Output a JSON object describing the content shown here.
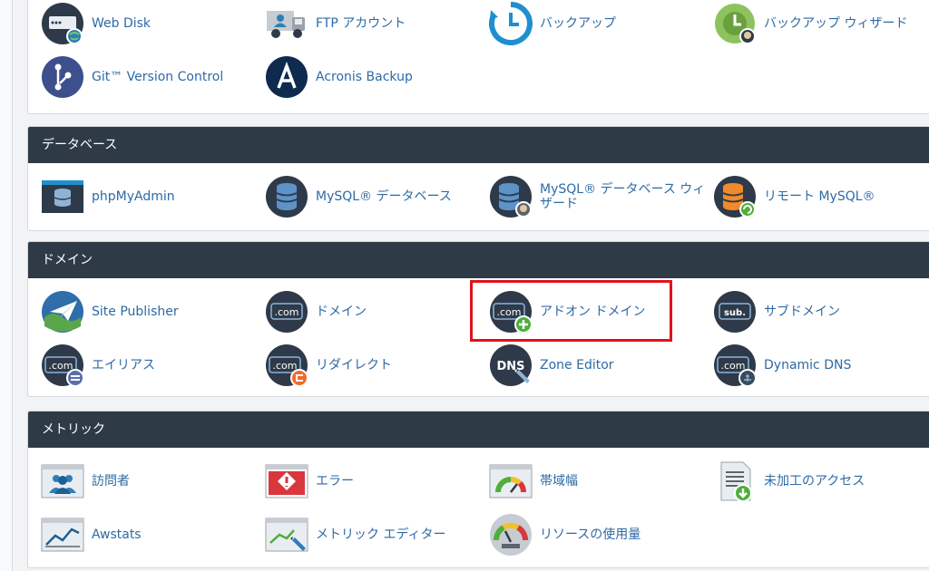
{
  "files": {
    "items": [
      {
        "label": "Web Disk",
        "icon": "web-disk-icon"
      },
      {
        "label": "FTP アカウント",
        "icon": "ftp-truck-icon"
      },
      {
        "label": "バックアップ",
        "icon": "backup-clock-icon"
      },
      {
        "label": "バックアップ ウィザード",
        "icon": "backup-wizard-icon"
      },
      {
        "label": "Git™ Version Control",
        "icon": "git-branch-icon"
      },
      {
        "label": "Acronis Backup",
        "icon": "acronis-icon"
      }
    ]
  },
  "databases": {
    "title": "データベース",
    "items": [
      {
        "label": "phpMyAdmin",
        "icon": "phpmyadmin-icon"
      },
      {
        "label": "MySQL® データベース",
        "icon": "database-icon"
      },
      {
        "label": "MySQL® データベース ウィザード",
        "icon": "database-wizard-icon"
      },
      {
        "label": "リモート MySQL®",
        "icon": "remote-database-icon"
      }
    ]
  },
  "domains": {
    "title": "ドメイン",
    "items": [
      {
        "label": "Site Publisher",
        "icon": "site-publisher-icon"
      },
      {
        "label": "ドメイン",
        "icon": "domain-com-icon",
        "badge": ".com"
      },
      {
        "label": "アドオン ドメイン",
        "icon": "addon-domain-icon",
        "badge": ".com"
      },
      {
        "label": "サブドメイン",
        "icon": "subdomain-icon",
        "badge": "sub."
      },
      {
        "label": "エイリアス",
        "icon": "alias-icon",
        "badge": ".com"
      },
      {
        "label": "リダイレクト",
        "icon": "redirect-icon",
        "badge": ".com"
      },
      {
        "label": "Zone Editor",
        "icon": "zone-editor-icon",
        "badge": "DNS"
      },
      {
        "label": "Dynamic DNS",
        "icon": "dynamic-dns-icon",
        "badge": ".com"
      }
    ]
  },
  "metrics": {
    "title": "メトリック",
    "items": [
      {
        "label": "訪問者",
        "icon": "visitors-icon"
      },
      {
        "label": "エラー",
        "icon": "errors-icon"
      },
      {
        "label": "帯域幅",
        "icon": "bandwidth-gauge-icon"
      },
      {
        "label": "未加工のアクセス",
        "icon": "raw-access-icon"
      },
      {
        "label": "Awstats",
        "icon": "awstats-chart-icon"
      },
      {
        "label": "メトリック エディター",
        "icon": "metrics-editor-icon"
      },
      {
        "label": "リソースの使用量",
        "icon": "resource-usage-icon"
      }
    ]
  },
  "colors": {
    "header_bg": "#2e3a46",
    "link": "#2d6aa5",
    "highlight": "#e0121b",
    "icon_dark": "#2e3a4a"
  }
}
